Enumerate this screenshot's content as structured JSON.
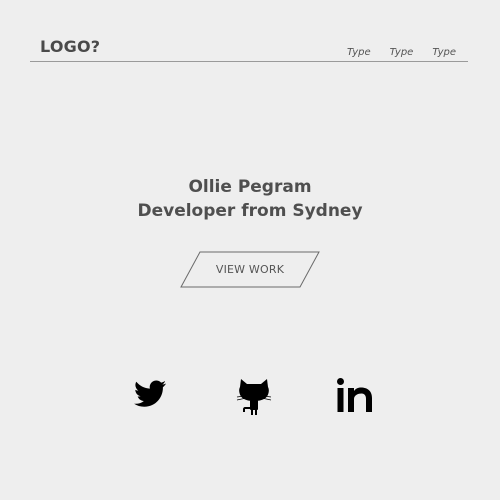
{
  "header": {
    "logo": "LOGO?",
    "nav": [
      "Type",
      "Type",
      "Type"
    ]
  },
  "hero": {
    "name": "Ollie Pegram",
    "tagline": "Developer from Sydney"
  },
  "cta": {
    "label": "VIEW WORK"
  },
  "social": [
    {
      "icon": "twitter-icon"
    },
    {
      "icon": "github-icon"
    },
    {
      "icon": "linkedin-icon"
    }
  ],
  "colors": {
    "background": "#eeeeee",
    "text": "#4a4a4a",
    "icon": "#000000"
  }
}
